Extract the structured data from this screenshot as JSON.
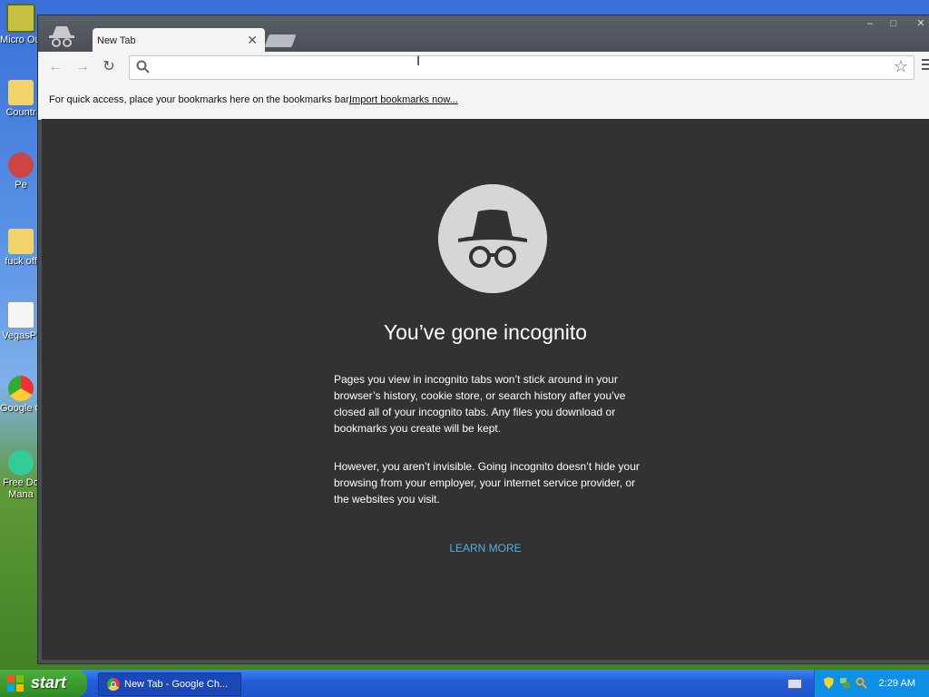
{
  "desktop": {
    "icons": [
      {
        "label": "Micro Outl",
        "name": "outlook"
      },
      {
        "label": "Countr",
        "name": "folder"
      },
      {
        "label": "Pe",
        "name": "app"
      },
      {
        "label": "fuck off",
        "name": "folder"
      },
      {
        "label": "VegasPr",
        "name": "document"
      },
      {
        "label": "Google C",
        "name": "chrome"
      },
      {
        "label": "Free Do Mana",
        "name": "download-manager"
      }
    ]
  },
  "browser": {
    "tab_title": "New Tab",
    "omnibox_value": "",
    "bookmarks_message": "For quick access, place your bookmarks here on the bookmarks bar.",
    "import_link": "Import bookmarks now...",
    "window_controls": {
      "minimize": "–",
      "maximize": "□",
      "close": "✕"
    }
  },
  "page": {
    "headline": "You’ve gone incognito",
    "paragraph1": "Pages you view in incognito tabs won’t stick around in your browser’s history, cookie store, or search history after you’ve closed all of your incognito tabs. Any files you download or bookmarks you create will be kept.",
    "paragraph2": "However, you aren’t invisible. Going incognito doesn’t hide your browsing from your employer, your internet service provider, or the websites you visit.",
    "learn_more": "LEARN MORE"
  },
  "taskbar": {
    "start_label": "start",
    "task_label": "New Tab - Google Ch...",
    "clock": "2:29 AM"
  },
  "colors": {
    "incognito_bg": "#323232",
    "link": "#4fb0e8",
    "taskbar": "#245edb"
  }
}
